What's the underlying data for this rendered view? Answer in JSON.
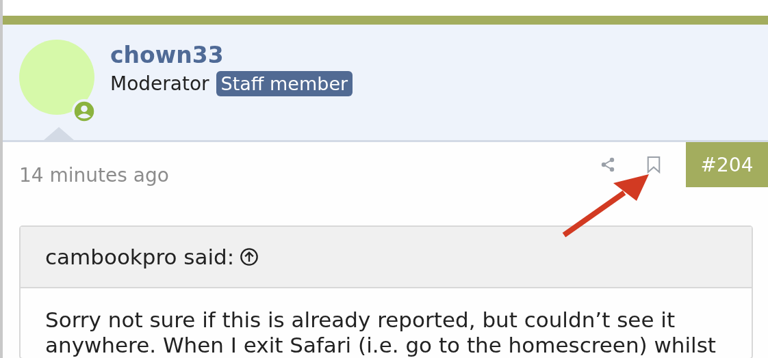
{
  "post": {
    "author": {
      "username": "chown33",
      "role": "Moderator",
      "badge": "Staff member"
    },
    "time": "14 minutes ago",
    "number": "#204",
    "quote": {
      "attribution": "cambookpro said:",
      "text": "Sorry not sure if this is already reported, but couldn’t see it anywhere. When I exit Safari (i.e. go to the homescreen) whilst"
    }
  }
}
